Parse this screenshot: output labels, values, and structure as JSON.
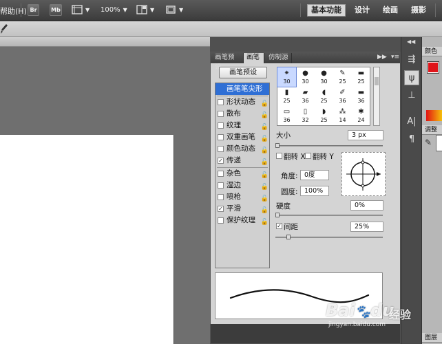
{
  "menu": {
    "help_label": "帮助(H)"
  },
  "app_bar": {
    "bridge_label": "Br",
    "minibridge_label": "Mb",
    "zoom_value": "100%",
    "workspaces": [
      {
        "label": "基本功能",
        "active": true
      },
      {
        "label": "设计",
        "active": false
      },
      {
        "label": "绘画",
        "active": false
      },
      {
        "label": "摄影",
        "active": false
      }
    ]
  },
  "brush_panel": {
    "tabs": [
      {
        "label": "画笔预设",
        "active": false
      },
      {
        "label": "画笔",
        "active": true
      },
      {
        "label": "仿制源",
        "active": false
      }
    ],
    "preset_button_label": "画笔预设",
    "options": [
      {
        "label": "画笔笔尖形状",
        "checked": null,
        "selected": true,
        "locked": false
      },
      {
        "label": "形状动态",
        "checked": false,
        "selected": false,
        "locked": true
      },
      {
        "label": "散布",
        "checked": false,
        "selected": false,
        "locked": true
      },
      {
        "label": "纹理",
        "checked": false,
        "selected": false,
        "locked": true
      },
      {
        "label": "双重画笔",
        "checked": false,
        "selected": false,
        "locked": true
      },
      {
        "label": "颜色动态",
        "checked": false,
        "selected": false,
        "locked": true
      },
      {
        "label": "传递",
        "checked": true,
        "selected": false,
        "locked": true
      },
      {
        "label": "杂色",
        "checked": false,
        "selected": false,
        "locked": true
      },
      {
        "label": "湿边",
        "checked": false,
        "selected": false,
        "locked": true
      },
      {
        "label": "喷枪",
        "checked": false,
        "selected": false,
        "locked": true
      },
      {
        "label": "平滑",
        "checked": true,
        "selected": false,
        "locked": true
      },
      {
        "label": "保护纹理",
        "checked": false,
        "selected": false,
        "locked": true
      }
    ],
    "brush_tips": [
      "30",
      "30",
      "30",
      "25",
      "25",
      "25",
      "36",
      "25",
      "36",
      "36",
      "36",
      "32",
      "25",
      "14",
      "24"
    ],
    "size_label": "大小",
    "size_value": "3 px",
    "flip_x_label": "翻转 X",
    "flip_y_label": "翻转 Y",
    "angle_label": "角度:",
    "angle_value": "0度",
    "roundness_label": "圆度:",
    "roundness_value": "100%",
    "hardness_label": "硬度",
    "hardness_value": "0%",
    "spacing_label": "间距",
    "spacing_checked": true,
    "spacing_value": "25%"
  },
  "right_dock": {
    "color_panel_label": "颜色",
    "adjust_panel_label": "调整",
    "layers_panel_label": "图层"
  },
  "watermark": {
    "brand": "Bai",
    "brand_tail": "du",
    "sub": "经验",
    "url": "jingyan.baidu.com"
  },
  "colors": {
    "selection_blue": "#2f6fd5",
    "foreground_red": "#e0141a"
  }
}
